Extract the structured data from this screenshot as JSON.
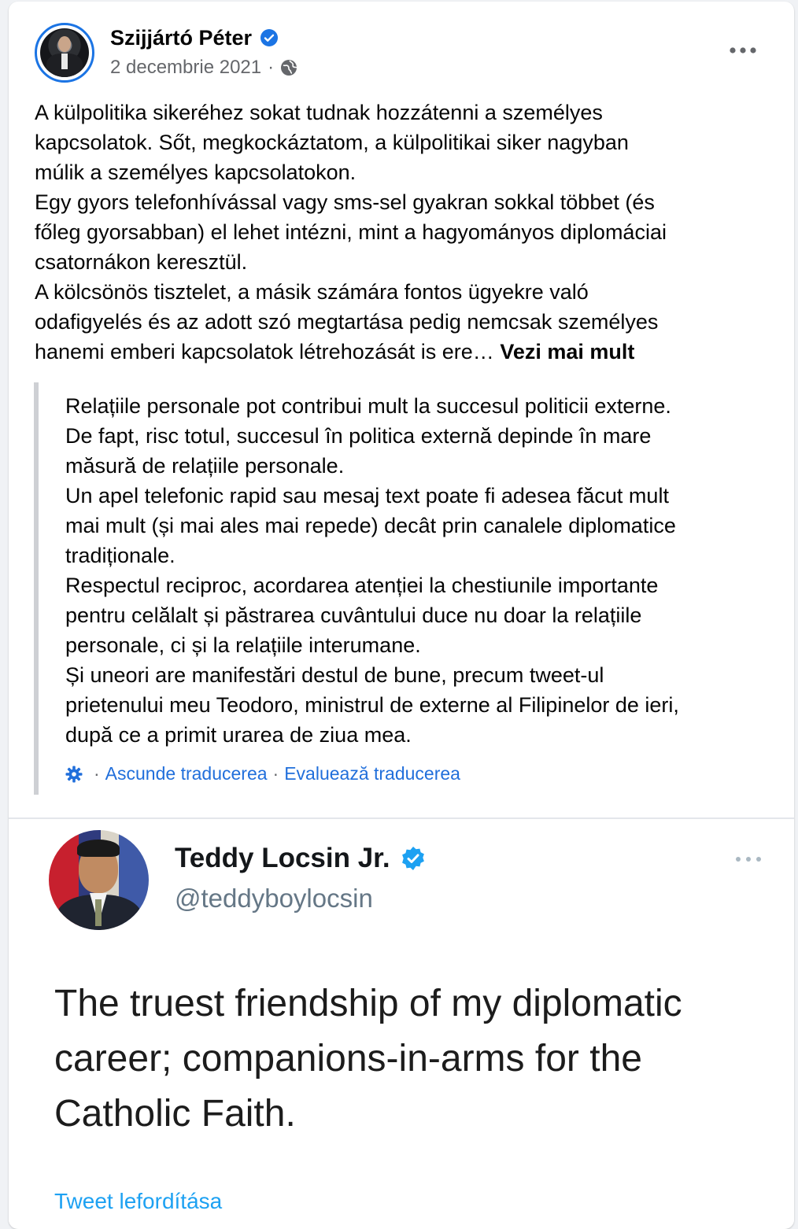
{
  "post": {
    "author": "Szijjártó Péter",
    "date": "2 decembrie 2021",
    "meta_separator": "·",
    "body_lines": [
      "A külpolitika sikeréhez sokat tudnak hozzátenni a személyes",
      "kapcsolatok. Sőt, megkockáztatom, a külpolitikai siker nagyban",
      "múlik a személyes kapcsolatokon.",
      "Egy gyors telefonhívással vagy sms-sel gyakran sokkal többet (és",
      "főleg gyorsabban) el lehet intézni, mint a hagyományos diplomáciai",
      "csatornákon keresztül.",
      "A kölcsönös tisztelet, a másik számára fontos ügyekre való",
      "odafigyelés és az adott szó megtartása pedig nemcsak személyes",
      "hanemi emberi kapcsolatok létrehozását is ere…"
    ],
    "see_more": "Vezi mai mult"
  },
  "translation": {
    "lines": [
      "Relațiile personale pot contribui mult la succesul politicii externe.",
      "De fapt, risc totul, succesul în politica externă depinde în mare",
      "măsură de relațiile personale.",
      "Un apel telefonic rapid sau mesaj text poate fi adesea făcut mult",
      "mai mult (și mai ales mai repede) decât prin canalele diplomatice",
      "tradiționale.",
      "Respectul reciproc, acordarea atenției la chestiunile importante",
      "pentru celălalt și păstrarea cuvântului duce nu doar la relațiile",
      "personale, ci și la relațiile interumane.",
      "Și uneori are manifestări destul de bune, precum tweet-ul",
      "prietenului meu Teodoro, ministrul de externe al Filipinelor de ieri,",
      "după ce a primit urarea de ziua mea."
    ],
    "separator": "·",
    "hide_label": "Ascunde traducerea",
    "rate_label": "Evaluează traducerea"
  },
  "tweet": {
    "name": "Teddy Locsin Jr.",
    "handle": "@teddyboylocsin",
    "body_lines": [
      "The truest friendship of my diplomatic",
      "career; companions-in-arms for the",
      "Catholic Faith."
    ],
    "translate_label": "Tweet lefordítása"
  },
  "colors": {
    "verified_blue": "#1b74e4",
    "link_blue": "#216fdb",
    "twitter_blue": "#1da1f2",
    "secondary_text": "#65676b"
  },
  "icons": {
    "verified": "verified-badge-icon",
    "audience": "globe-icon",
    "more": "more-horizontal-icon",
    "translation_settings": "gear-icon"
  }
}
